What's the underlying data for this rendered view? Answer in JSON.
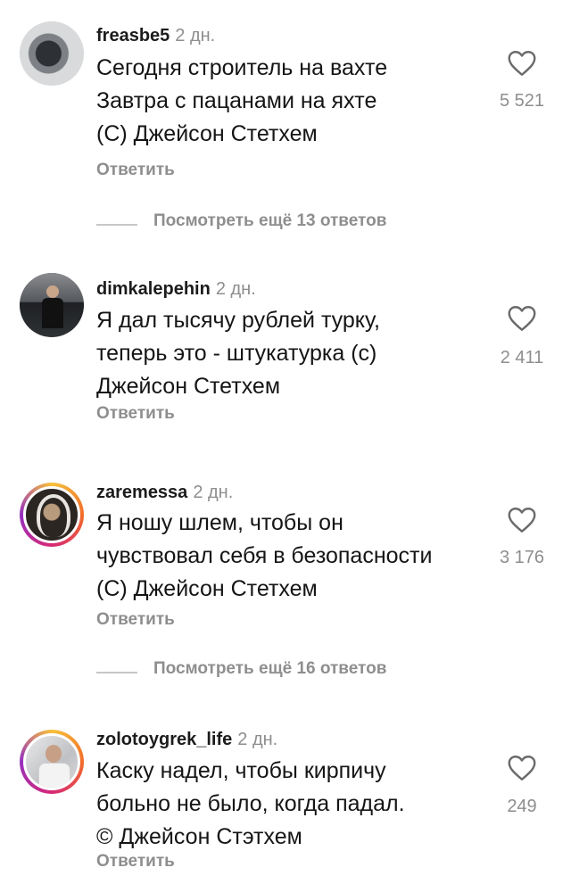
{
  "comments": [
    {
      "username": "freasbe5",
      "time": "2 дн.",
      "lines": [
        "Сегодня строитель на вахте",
        "Завтра с пацанами на яхте",
        "(С) Джейсон Стетхем"
      ],
      "reply_label": "Ответить",
      "likes": "5 521"
    },
    {
      "username": "dimkalepehin",
      "time": "2 дн.",
      "lines": [
        "Я дал тысячу рублей турку,",
        "теперь это - штукатурка (с)",
        "Джейсон Стетхем"
      ],
      "reply_label": "Ответить",
      "likes": "2 411"
    },
    {
      "username": "zaremessa",
      "time": "2 дн.",
      "lines": [
        "Я ношу шлем, чтобы он",
        "чувствовал себя в безопасности",
        "(С) Джейсон Стетхем"
      ],
      "reply_label": "Ответить",
      "likes": "3 176"
    },
    {
      "username": "zolotoygrek_life",
      "time": "2 дн.",
      "lines": [
        "Каску надел, чтобы кирпичу",
        "больно не было, когда падал.",
        "© Джейсон Стэтхем"
      ],
      "reply_label": "Ответить",
      "likes": "249"
    }
  ],
  "view_more": [
    {
      "label": "Посмотреть ещё 13 ответов"
    },
    {
      "label": "Посмотреть ещё 16 ответов"
    }
  ],
  "icons": {
    "like": "heart-outline-icon"
  },
  "colors": {
    "secondary_text": "#8e8e8e",
    "story_ring": [
      "#f7c13b",
      "#f26c2a",
      "#d62976",
      "#962fbf"
    ]
  }
}
